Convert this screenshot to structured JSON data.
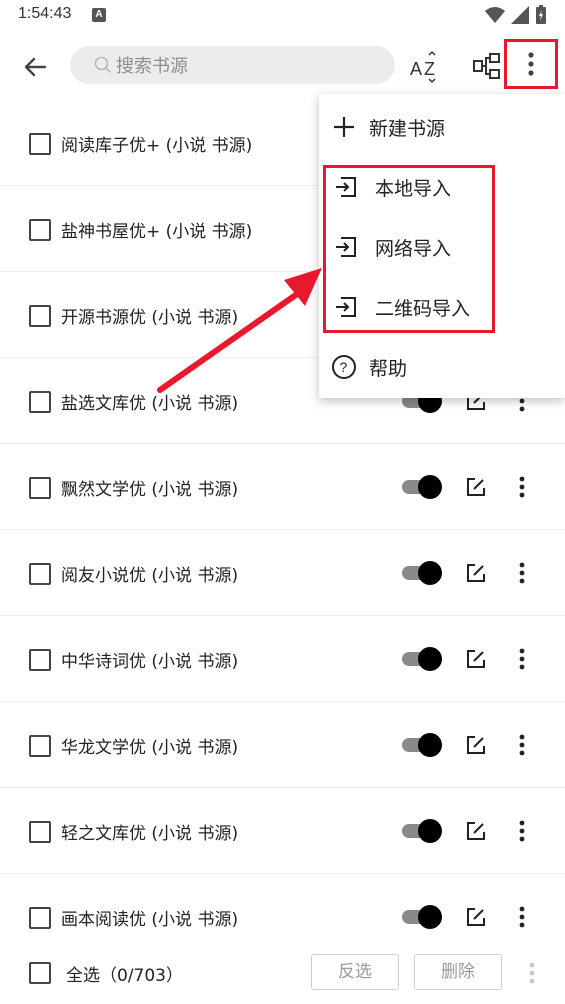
{
  "status_bar": {
    "time": "1:54:43",
    "notification_letter": "A"
  },
  "toolbar": {
    "back_icon": "arrow-left-icon",
    "search_placeholder": "搜索书源",
    "sort_icon": "sort-az-icon",
    "group_icon": "group-tree-icon",
    "more_icon": "more-vert-icon"
  },
  "sources": [
    {
      "label": "阅读库子优+ (小说 书源)"
    },
    {
      "label": "盐神书屋优+ (小说 书源)"
    },
    {
      "label": "开源书源优 (小说 书源)"
    },
    {
      "label": "盐选文库优 (小说 书源)"
    },
    {
      "label": "飘然文学优 (小说 书源)"
    },
    {
      "label": "阅友小说优 (小说 书源)"
    },
    {
      "label": "中华诗词优 (小说 书源)"
    },
    {
      "label": "华龙文学优 (小说 书源)"
    },
    {
      "label": "轻之文库优 (小说 书源)"
    },
    {
      "label": "画本阅读优 (小说 书源)"
    }
  ],
  "menu": {
    "new_source": "新建书源",
    "local_import": "本地导入",
    "network_import": "网络导入",
    "qr_import": "二维码导入",
    "help": "帮助"
  },
  "bottom_bar": {
    "select_all": "全选（0/703）",
    "invert": "反选",
    "delete": "删除"
  },
  "colors": {
    "annotation_red": "#e8192c",
    "toggle_thumb": "#000000",
    "toggle_track": "#8a8a8a"
  }
}
